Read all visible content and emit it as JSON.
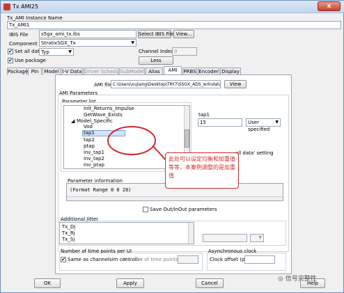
{
  "window": {
    "title": "Tx AMI25",
    "close_glyph": "x"
  },
  "instance": {
    "label": "Tx_AMI Instance Name",
    "value": "Tx_AMI1"
  },
  "ibis": {
    "label": "IBIS File",
    "value": "s5gx_ami_tx.ibs",
    "select_label": "Select IBIS File...",
    "view_label": "View..."
  },
  "component": {
    "label": "Component",
    "value": "StratixSGX_Tx"
  },
  "set_all_data": {
    "label": "Set all data",
    "checked": "✔",
    "value": "Typ"
  },
  "channel_index": {
    "label": "Channel Index",
    "value": "0"
  },
  "use_package": {
    "label": "Use package",
    "checked": "✔",
    "less_label": "Less"
  },
  "tabs": [
    {
      "label": "Package"
    },
    {
      "label": "Pin"
    },
    {
      "label": "Model"
    },
    {
      "label": "I-V Data"
    },
    {
      "label": "Driver Schedule"
    },
    {
      "label": "SubModel"
    },
    {
      "label": "Alias"
    },
    {
      "label": "AMI"
    },
    {
      "label": "PRBS"
    },
    {
      "label": "Encoder"
    },
    {
      "label": "Display"
    }
  ],
  "ami": {
    "file_label": "AMI file",
    "file_value": "C:\\Users\\xujiang\\Desktop\\TRY7\\SSGX_ADS_wrk\\data\\p5_tx_1",
    "view_label": "View",
    "params_group": "AMI Parameters",
    "param_list_label": "Parameter list",
    "params": [
      "Init_Returns_Impulse",
      "GetWave_Exists",
      "Model_Specific",
      "Vod",
      "tap1",
      "tap2",
      "ptap",
      "inv_tap1",
      "inv_tap2",
      "inv_ptap"
    ],
    "selected_param_name": "tap1",
    "selected_param_value": "15",
    "value_mode": "User specified",
    "all_data_partial": "all data' setting",
    "info_label": "Parameter information",
    "info_value": "(Format Range 0 0 20)",
    "save_label": "Save Out/InOut parameters"
  },
  "jitter": {
    "label": "Additional Jitter",
    "items": [
      "Tx_Dj",
      "Tx_Rj",
      "Tx_Sj"
    ]
  },
  "time_points": {
    "label": "Number of time points per UI",
    "same_label": "Same as channelsim controller",
    "checked": "✔",
    "per_ui_label": "Number of time points per UI"
  },
  "async_clock": {
    "label": "Asynchronous clock",
    "offset_label": "Clock offset (ppm)"
  },
  "callout": {
    "text": "此处可以设定均衡和加重值等等，本案例调整的是加重值"
  },
  "buttons": {
    "ok": "OK",
    "apply": "Apply",
    "cancel": "Cancel",
    "help": "Help"
  },
  "watermark": {
    "text": "信号完整性"
  },
  "colors": {
    "accent_red": "#d22c2c",
    "selection": "#cfe3fb"
  }
}
